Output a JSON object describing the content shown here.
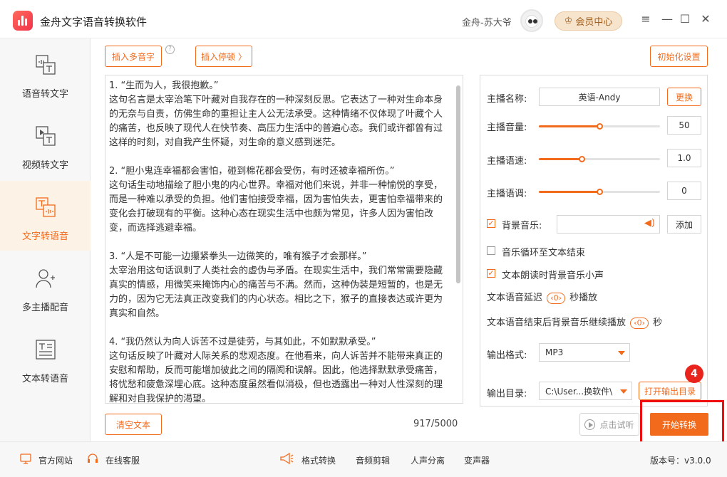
{
  "app": {
    "title": "金舟文字语音转换软件",
    "username": "金舟-苏大爷",
    "vip_label": "会员中心",
    "accent_color": "#f26b1d"
  },
  "window_controls": {
    "menu": "≡",
    "minimize": "—",
    "maximize": "☐",
    "close": "✕"
  },
  "sidebar": {
    "items": [
      {
        "label": "语音转文字",
        "icon": "speech-to-text-icon"
      },
      {
        "label": "视频转文字",
        "icon": "video-to-text-icon"
      },
      {
        "label": "文字转语音",
        "icon": "text-to-speech-icon",
        "active": true
      },
      {
        "label": "多主播配音",
        "icon": "multi-voice-icon"
      },
      {
        "label": "文本转语音",
        "icon": "document-to-speech-icon"
      }
    ]
  },
  "toolbar": {
    "insert_polyphone": "插入多音字",
    "insert_pause": "插入停顿 〉",
    "help": "?",
    "reset_settings": "初始化设置"
  },
  "editor": {
    "content": "1. “生而为人，我很抱歉。”\n这句名言是太宰治笔下叶藏对自我存在的一种深刻反思。它表达了一种对生命本身的无奈与自责，仿佛生命的重担让主人公无法承受。这种情绪不仅体现了叶藏个人的痛苦，也反映了现代人在快节奏、高压力生活中的普遍心态。我们或许都曾有过这样的时刻，对自我产生怀疑，对生命的意义感到迷茫。\n\n2. “胆小鬼连幸福都会害怕，碰到棉花都会受伤，有时还被幸福所伤。”\n这句话生动地描绘了胆小鬼的内心世界。幸福对他们来说，并非一种愉悦的享受，而是一种难以承受的负担。他们害怕接受幸福，因为害怕失去，更害怕幸福带来的变化会打破现有的平衡。这种心态在现实生活中也颇为常见，许多人因为害怕改变，而选择逃避幸福。\n\n3. “人是不可能一边攥紧拳头一边微笑的，唯有猴子才会那样。”\n太宰治用这句话讽刺了人类社会的虚伪与矛盾。在现实生活中，我们常常需要隐藏真实的情感，用微笑来掩饰内心的痛苦与不满。然而，这种伪装是短暂的，也是无力的，因为它无法真正改变我们的内心状态。相比之下，猴子的直接表达或许更为真实和自然。\n\n4. “我仍然认为向人诉苦不过是徒劳，与其如此，不如默默承受。”\n这句话反映了叶藏对人际关系的悲观态度。在他看来，向人诉苦并不能带来真正的安慰和帮助，反而可能增加彼此之间的隔阂和误解。因此，他选择默默承受痛苦，将忧愁和疲惫深埋心底。这种态度虽然看似消极，但也透露出一种对人性深刻的理解和对自我保护的渴望。",
    "char_count": "917/5000",
    "clear_label": "清空文本"
  },
  "settings": {
    "anchor_label": "主播名称:",
    "anchor_value": "英语-Andy",
    "change_label": "更换",
    "volume_label": "主播音量:",
    "volume_value": "50",
    "volume_level": 0.5,
    "speed_label": "主播语速:",
    "speed_value": "1.0",
    "speed_level": 0.35,
    "pitch_label": "主播语调:",
    "pitch_value": "0",
    "pitch_level": 0.5,
    "bgm_label": "背景音乐:",
    "bgm_checked": true,
    "bgm_value": "",
    "add_label": "添加",
    "loop_label": "音乐循环至文本结束",
    "loop_checked": false,
    "duck_label": "文本朗读时背景音乐小声",
    "duck_checked": true,
    "delay_prefix": "文本语音延迟",
    "delay_value": "0",
    "delay_suffix": "秒播放",
    "continue_prefix": "文本语音结束后背景音乐继续播放",
    "continue_value": "0",
    "continue_suffix": "秒",
    "format_label": "输出格式:",
    "format_value": "MP3",
    "dir_label": "输出目录:",
    "dir_value": "C:\\User...换软件\\",
    "open_dir_label": "打开输出目录"
  },
  "actions": {
    "trial_label": "点击试听",
    "start_label": "开始转换",
    "badge": "4"
  },
  "footer": {
    "website": "官方网站",
    "service": "在线客服",
    "format_convert": "格式转换",
    "audio_edit": "音频剪辑",
    "voice_separate": "人声分离",
    "voice_changer": "变声器",
    "version": "版本号：v3.0.0"
  }
}
